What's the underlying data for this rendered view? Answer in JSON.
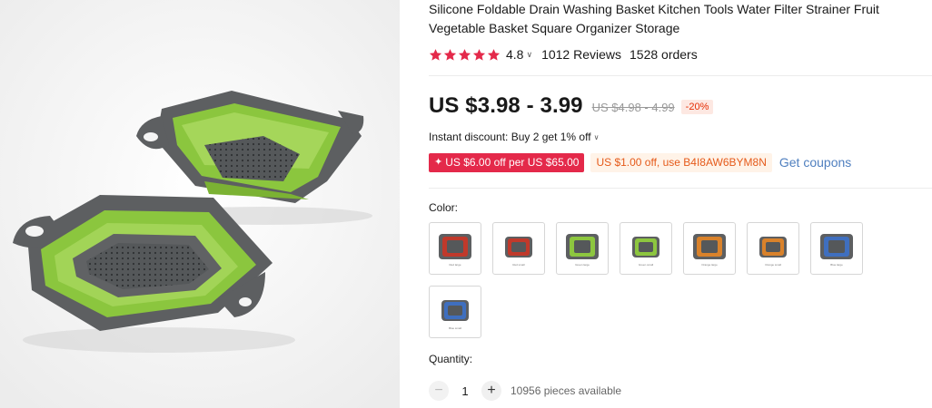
{
  "product": {
    "title": "Silicone Foldable Drain Washing Basket Kitchen Tools Water Filter Strainer Fruit Vegetable Basket Square Organizer Storage",
    "rating": "4.8",
    "reviews": "1012 Reviews",
    "orders": "1528 orders",
    "price": "US $3.98 - 3.99",
    "original_price": "US $4.98 - 4.99",
    "discount_pct": "-20%",
    "instant_discount": "Instant discount: Buy 2 get 1% off",
    "coupon_store": "US $6.00 off per US $65.00",
    "coupon_code": "US $1.00 off, use B4I8AW6BYM8N",
    "get_coupons": "Get coupons"
  },
  "colors": {
    "label": "Color:",
    "options": [
      {
        "name": "Red large",
        "color": "#c0392b"
      },
      {
        "name": "Red small",
        "color": "#c0392b"
      },
      {
        "name": "Green large",
        "color": "#8dc63f"
      },
      {
        "name": "Green small",
        "color": "#8dc63f"
      },
      {
        "name": "Orange large",
        "color": "#d9822b"
      },
      {
        "name": "Orange small",
        "color": "#d9822b"
      },
      {
        "name": "Blue large",
        "color": "#3f6fbf"
      },
      {
        "name": "Blue small",
        "color": "#3f6fbf"
      }
    ]
  },
  "quantity": {
    "label": "Quantity:",
    "value": "1",
    "minus_label": "−",
    "plus_label": "+",
    "available": "10956 pieces available"
  },
  "theme": {
    "star_color": "#e4294a",
    "coupon_red": "#e4294a",
    "product_green": "#8bc63e",
    "product_gray": "#5a5c5e"
  }
}
